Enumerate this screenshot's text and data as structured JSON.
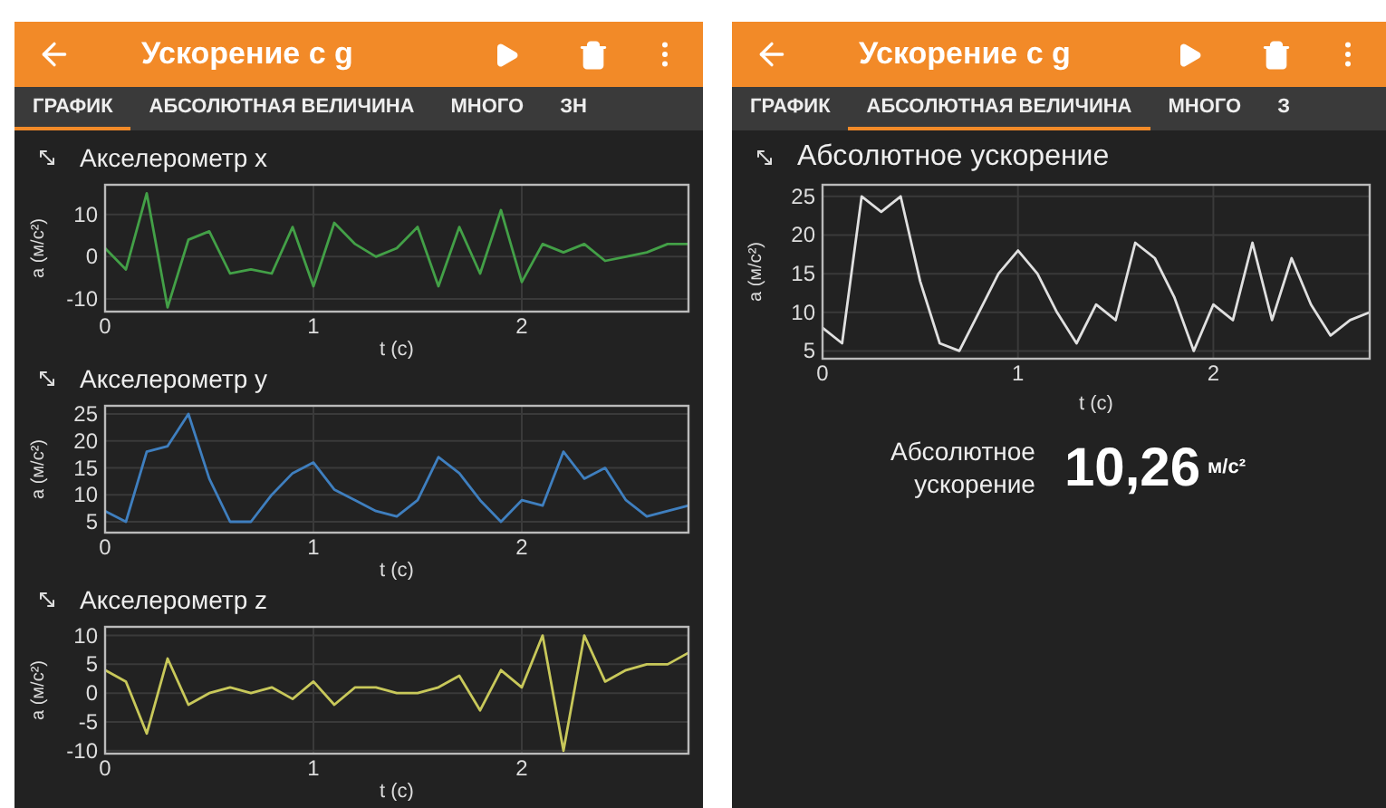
{
  "screens": [
    {
      "title": "Ускорение с g",
      "tabs": [
        {
          "label": "ГРАФИК",
          "selected": true
        },
        {
          "label": "АБСОЛЮТНАЯ ВЕЛИЧИНА",
          "selected": false
        },
        {
          "label": "МНОГО",
          "selected": false
        },
        {
          "label": "ЗН",
          "selected": false
        }
      ],
      "panels": [
        {
          "kind": "graph",
          "title": "Акселерометр x",
          "chart_data": {
            "type": "line",
            "grid": true,
            "xlabel": "t (c)",
            "ylabel": "a (м/с²)",
            "xlim": [
              0,
              2.8
            ],
            "ylim": [
              -13,
              17
            ],
            "xticks": [
              0,
              1,
              2
            ],
            "yticks": [
              -10,
              0,
              10
            ],
            "x": [
              0,
              0.1,
              0.2,
              0.3,
              0.4,
              0.5,
              0.6,
              0.7,
              0.8,
              0.9,
              1,
              1.1,
              1.2,
              1.3,
              1.4,
              1.5,
              1.6,
              1.7,
              1.8,
              1.9,
              2,
              2.1,
              2.2,
              2.3,
              2.4,
              2.5,
              2.6,
              2.7,
              2.8
            ],
            "series": [
              {
                "color": "#43a047",
                "values": [
                  2,
                  -3,
                  15,
                  -12,
                  4,
                  6,
                  -4,
                  -3,
                  -4,
                  7,
                  -7,
                  8,
                  3,
                  0,
                  2,
                  7,
                  -7,
                  7,
                  -4,
                  11,
                  -6,
                  3,
                  1,
                  3,
                  -1,
                  0,
                  1,
                  3,
                  3
                ]
              }
            ]
          }
        },
        {
          "kind": "graph",
          "title": "Акселерометр y",
          "chart_data": {
            "type": "line",
            "grid": true,
            "xlabel": "t (c)",
            "ylabel": "a (м/с²)",
            "xlim": [
              0,
              2.8
            ],
            "ylim": [
              3,
              26.5
            ],
            "xticks": [
              0,
              1,
              2
            ],
            "yticks": [
              5,
              10,
              15,
              20,
              25
            ],
            "x": [
              0,
              0.1,
              0.2,
              0.3,
              0.4,
              0.5,
              0.6,
              0.7,
              0.8,
              0.9,
              1,
              1.1,
              1.2,
              1.3,
              1.4,
              1.5,
              1.6,
              1.7,
              1.8,
              1.9,
              2,
              2.1,
              2.2,
              2.3,
              2.4,
              2.5,
              2.6,
              2.7,
              2.8
            ],
            "series": [
              {
                "color": "#3f7fbf",
                "values": [
                  7,
                  5,
                  18,
                  19,
                  25,
                  13,
                  5,
                  5,
                  10,
                  14,
                  16,
                  11,
                  9,
                  7,
                  6,
                  9,
                  17,
                  14,
                  9,
                  5,
                  9,
                  8,
                  18,
                  13,
                  15,
                  9,
                  6,
                  7,
                  8
                ]
              }
            ]
          }
        },
        {
          "kind": "graph",
          "title": "Акселерометр z",
          "chart_data": {
            "type": "line",
            "grid": true,
            "xlabel": "t (c)",
            "ylabel": "a (м/с²)",
            "xlim": [
              0,
              2.8
            ],
            "ylim": [
              -10.5,
              11.5
            ],
            "xticks": [
              0,
              1,
              2
            ],
            "yticks": [
              -10,
              -5,
              0,
              5,
              10
            ],
            "x": [
              0,
              0.1,
              0.2,
              0.3,
              0.4,
              0.5,
              0.6,
              0.7,
              0.8,
              0.9,
              1,
              1.1,
              1.2,
              1.3,
              1.4,
              1.5,
              1.6,
              1.7,
              1.8,
              1.9,
              2,
              2.1,
              2.2,
              2.3,
              2.4,
              2.5,
              2.6,
              2.7,
              2.8
            ],
            "series": [
              {
                "color": "#c8c85a",
                "values": [
                  4,
                  2,
                  -7,
                  6,
                  -2,
                  0,
                  1,
                  0,
                  1,
                  -1,
                  2,
                  -2,
                  1,
                  1,
                  0,
                  0,
                  1,
                  3,
                  -3,
                  4,
                  1,
                  10,
                  -10,
                  10,
                  2,
                  4,
                  5,
                  5,
                  7
                ]
              }
            ]
          }
        }
      ]
    },
    {
      "title": "Ускорение с g",
      "tabs": [
        {
          "label": "ГРАФИК",
          "selected": false
        },
        {
          "label": "АБСОЛЮТНАЯ ВЕЛИЧИНА",
          "selected": true
        },
        {
          "label": "МНОГО",
          "selected": false
        },
        {
          "label": "З",
          "selected": false
        }
      ],
      "panels": [
        {
          "kind": "graph",
          "title": "Абсолютное ускорение",
          "chart_data": {
            "type": "line",
            "grid": true,
            "xlabel": "t (c)",
            "ylabel": "a (м/с²)",
            "xlim": [
              0,
              2.8
            ],
            "ylim": [
              4,
              26.5
            ],
            "xticks": [
              0,
              1,
              2
            ],
            "yticks": [
              5,
              10,
              15,
              20,
              25
            ],
            "x": [
              0,
              0.1,
              0.2,
              0.3,
              0.4,
              0.5,
              0.6,
              0.7,
              0.8,
              0.9,
              1,
              1.1,
              1.2,
              1.3,
              1.4,
              1.5,
              1.6,
              1.7,
              1.8,
              1.9,
              2,
              2.1,
              2.2,
              2.3,
              2.4,
              2.5,
              2.6,
              2.7,
              2.8
            ],
            "series": [
              {
                "color": "#e0e0e0",
                "values": [
                  8,
                  6,
                  25,
                  23,
                  25,
                  14,
                  6,
                  5,
                  10,
                  15,
                  18,
                  15,
                  10,
                  6,
                  11,
                  9,
                  19,
                  17,
                  12,
                  5,
                  11,
                  9,
                  19,
                  9,
                  17,
                  11,
                  7,
                  9,
                  10
                ]
              }
            ]
          }
        },
        {
          "kind": "value",
          "label": "Абсолютное ускорение",
          "value": "10,26",
          "unit": "м/с²"
        }
      ]
    }
  ]
}
